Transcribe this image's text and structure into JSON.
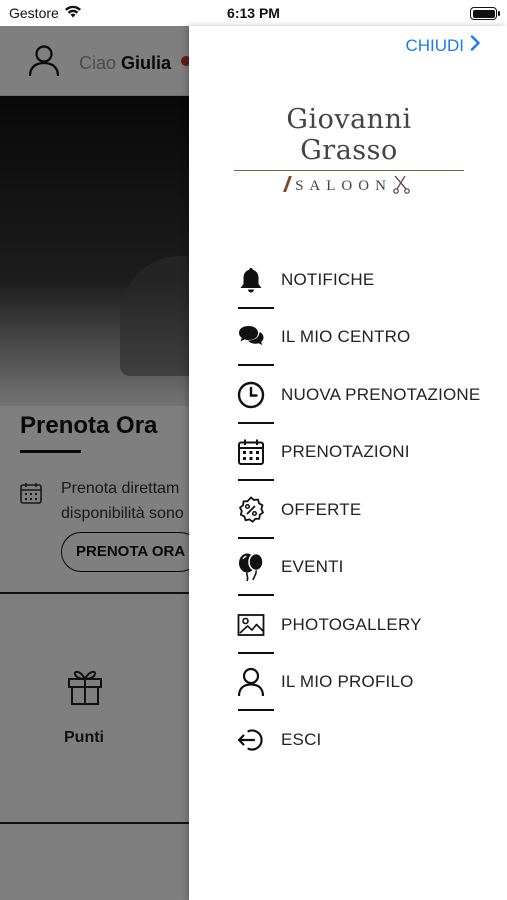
{
  "status_bar": {
    "carrier": "Gestore",
    "time": "6:13 PM"
  },
  "background_app": {
    "greeting_prefix": "Ciao",
    "user_name": "Giulia",
    "section_title": "Prenota Ora",
    "description_line1": "Prenota direttam",
    "description_line2": "disponibilità sono",
    "cta_label": "PRENOTA ORA",
    "points_label": "Punti"
  },
  "drawer": {
    "close_label": "CHIUDI",
    "logo": {
      "name": "Giovanni Grasso",
      "subtitle": "SALOON"
    },
    "accent_color": "#1a7cf3",
    "menu": [
      {
        "label": "NOTIFICHE",
        "icon": "bell-icon"
      },
      {
        "label": "IL MIO CENTRO",
        "icon": "chat-bubbles-icon"
      },
      {
        "label": "NUOVA PRENOTAZIONE",
        "icon": "clock-icon"
      },
      {
        "label": "PRENOTAZIONI",
        "icon": "calendar-icon"
      },
      {
        "label": "OFFERTE",
        "icon": "discount-badge-icon"
      },
      {
        "label": "EVENTI",
        "icon": "balloons-icon"
      },
      {
        "label": "PHOTOGALLERY",
        "icon": "image-icon"
      },
      {
        "label": "IL MIO PROFILO",
        "icon": "user-icon"
      },
      {
        "label": "ESCI",
        "icon": "logout-icon"
      }
    ]
  }
}
